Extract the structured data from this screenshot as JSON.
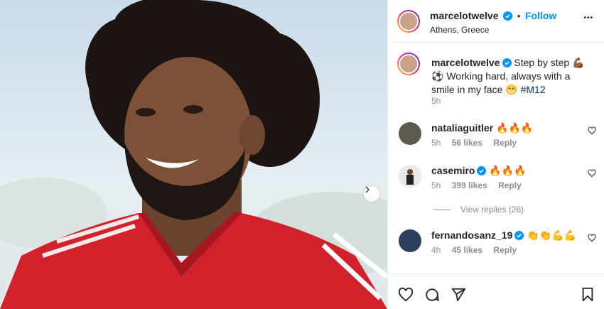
{
  "post": {
    "username": "marcelotwelve",
    "follow_label": "Follow",
    "separator": "•",
    "location": "Athens, Greece",
    "more_label": "•••"
  },
  "caption": {
    "username": "marcelotwelve",
    "text": "Step by step 💪🏾⚽ Working hard, always with a smile in my face 😁 ",
    "hashtag": "#M12",
    "time": "5h"
  },
  "comments": [
    {
      "username": "nataliaguitler",
      "verified": false,
      "text": "🔥🔥🔥",
      "time": "5h",
      "likes": "56 likes",
      "reply": "Reply"
    },
    {
      "username": "casemiro",
      "verified": true,
      "text": "🔥🔥🔥",
      "time": "5h",
      "likes": "399 likes",
      "reply": "Reply"
    },
    {
      "username": "fernandosanz_19",
      "verified": true,
      "text": "👏👏💪💪",
      "time": "4h",
      "likes": "45 likes",
      "reply": "Reply"
    }
  ],
  "view_replies": "View replies (26)",
  "colors": {
    "accent": "#0095f6",
    "verified": "#0095f6",
    "text": "#262626",
    "muted": "#8e8e8e",
    "jersey": "#d3212b"
  },
  "icons": [
    "verified-badge-icon",
    "more-options-icon",
    "heart-icon",
    "comment-icon",
    "share-icon",
    "bookmark-icon",
    "chevron-right-icon"
  ]
}
